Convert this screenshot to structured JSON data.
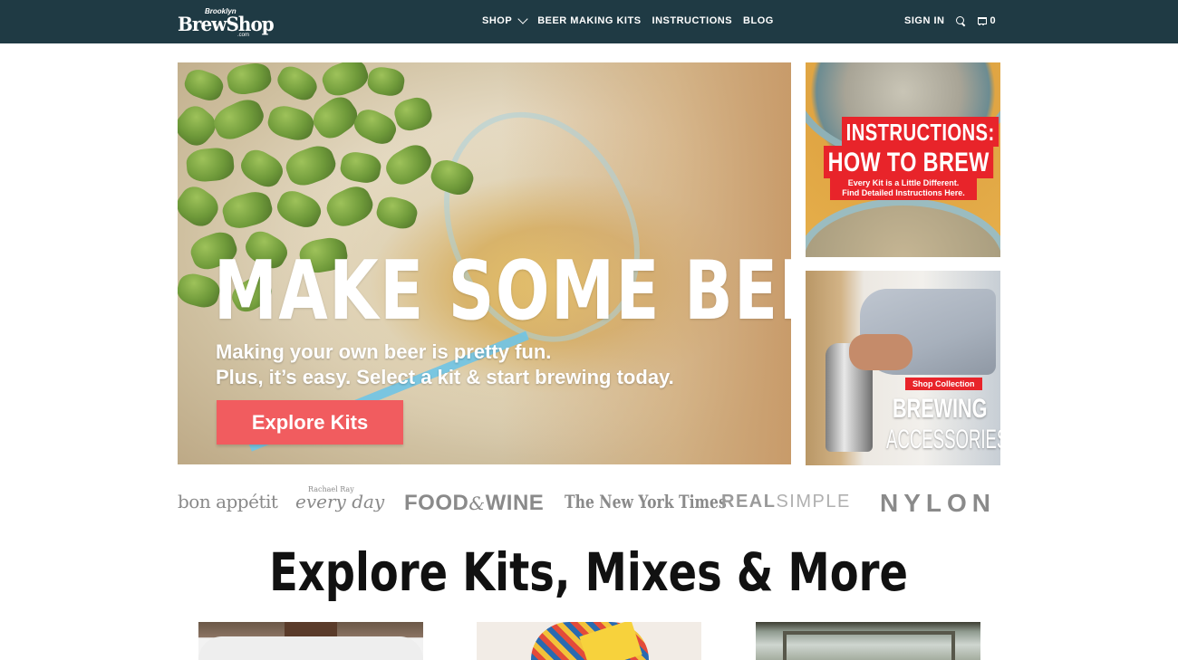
{
  "header": {
    "logo": {
      "top": "Brooklyn",
      "main": "BrewShop",
      "sub": ".com"
    },
    "nav": [
      {
        "label": "SHOP"
      },
      {
        "label": "BEER MAKING KITS"
      },
      {
        "label": "INSTRUCTIONS"
      },
      {
        "label": "BLOG"
      }
    ],
    "sign_in": "SIGN IN",
    "cart_count": "0"
  },
  "hero": {
    "title": "MAKE SOME BEER",
    "subtitle_line1": "Making your own beer is pretty fun.",
    "subtitle_line2": "Plus, it’s easy. Select a kit & start brewing today.",
    "button": "Explore Kits"
  },
  "promo_instructions": {
    "line1": "INSTRUCTIONS:",
    "line2": "HOW TO BREW",
    "line3": "Every Kit is a Little Different.",
    "line4": "Find Detailed Instructions Here."
  },
  "promo_accessories": {
    "badge": "Shop Collection",
    "line1": "BREWING",
    "line2": "ACCESSORIES"
  },
  "press": {
    "bon_appetit": "bon appétit",
    "every_day_small": "Rachael Ray",
    "every_day": "every day",
    "food_wine_a": "FOOD",
    "food_wine_amp": "&",
    "food_wine_b": "WINE",
    "nyt": "The New York Times",
    "real": "REAL",
    "simple": "SIMPLE",
    "nylon": "NYLON"
  },
  "section": {
    "title": "Explore Kits, Mixes & More"
  },
  "colors": {
    "header_bg": "#1f3a44",
    "accent_red": "#e8242a",
    "button_coral": "#f15c5f"
  }
}
